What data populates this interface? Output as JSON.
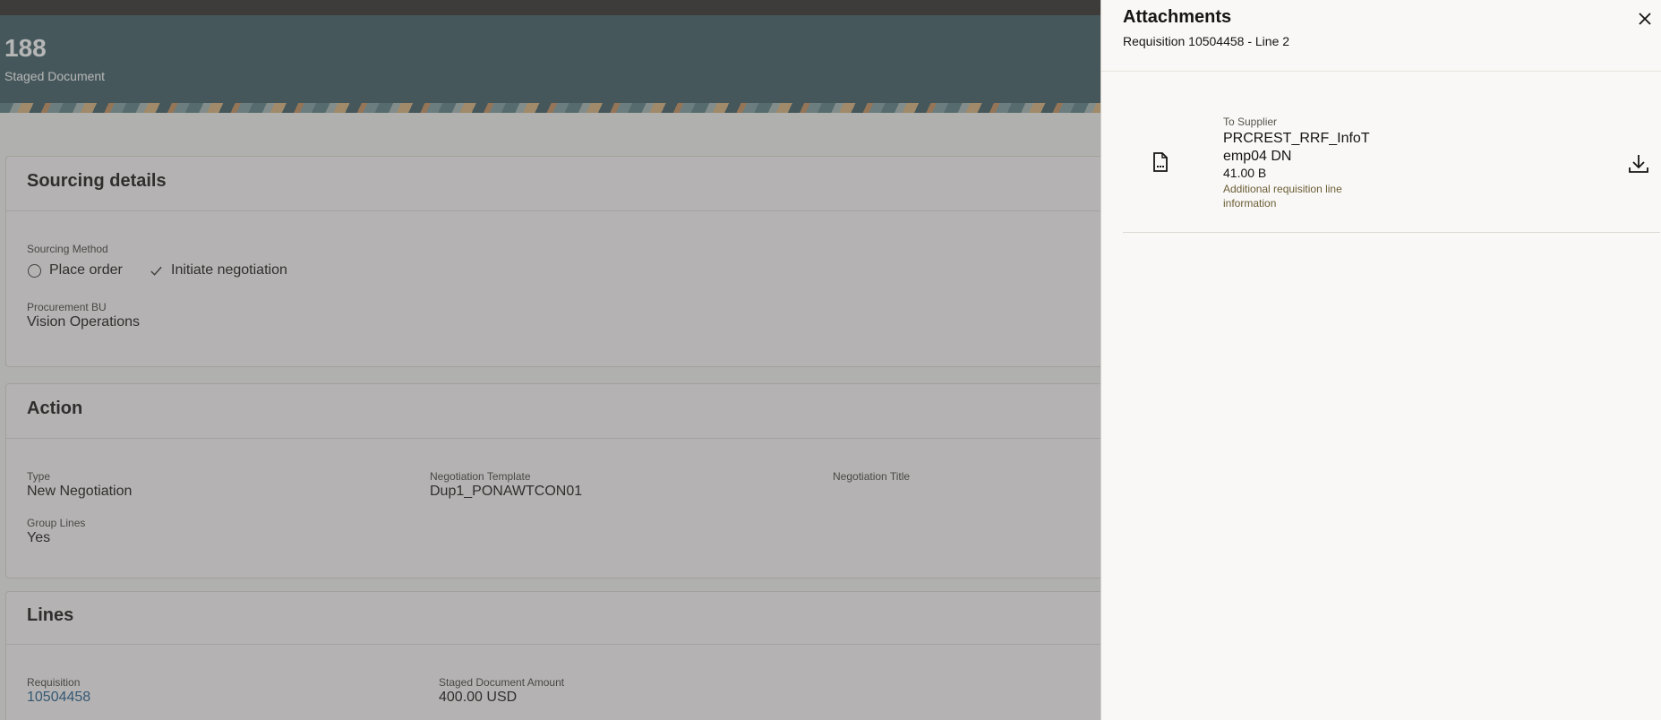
{
  "header": {
    "number": "188",
    "subtitle": "Staged Document"
  },
  "sourcing": {
    "title": "Sourcing details",
    "method_label": "Sourcing Method",
    "option_place_order": "Place order",
    "option_initiate": "Initiate negotiation",
    "bu_label": "Procurement BU",
    "bu_value": "Vision Operations"
  },
  "action": {
    "title": "Action",
    "type_label": "Type",
    "type_value": "New Negotiation",
    "template_label": "Negotiation Template",
    "template_value": "Dup1_PONAWTCON01",
    "neg_title_label": "Negotiation Title",
    "group_label": "Group Lines",
    "group_value": "Yes"
  },
  "lines": {
    "title": "Lines",
    "req_label": "Requisition",
    "req_value": "10504458",
    "amount_label": "Staged Document Amount",
    "amount_value": "400.00 USD"
  },
  "drawer": {
    "title": "Attachments",
    "subtitle": "Requisition 10504458 - Line 2",
    "close_icon": "close-icon",
    "attachment": {
      "category": "To Supplier",
      "name": "PRCREST_RRF_InfoTemp04 DN",
      "size": "41.00 B",
      "description": "Additional requisition line information",
      "icon": "file-icon",
      "download_icon": "download-icon"
    }
  }
}
